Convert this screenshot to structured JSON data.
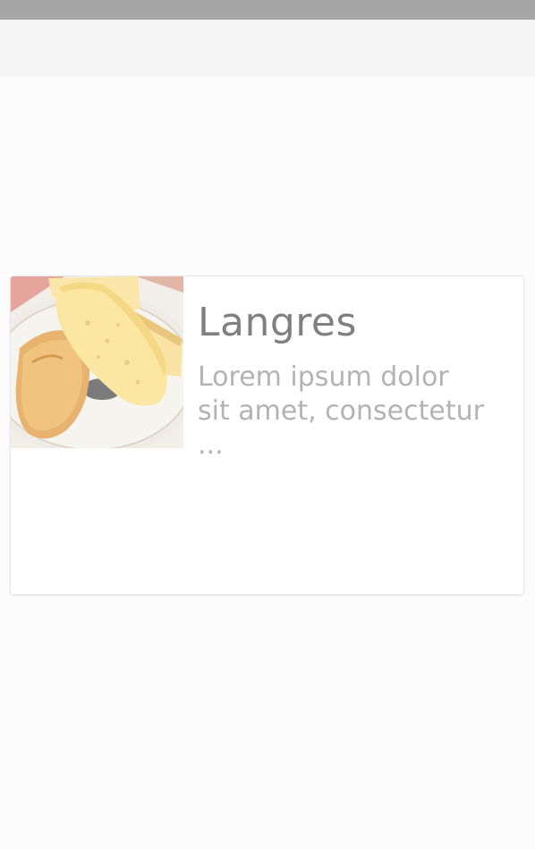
{
  "card": {
    "title": "Langres",
    "description_line1": "Lorem ipsum dolor",
    "description_line2": "sit amet, consectetur ...",
    "image_icon": "cheese-image"
  },
  "colors": {
    "status_bar": "#a6a6a6",
    "app_bar": "#f6f5f6",
    "background": "#fcfcfc",
    "title_text": "#808080",
    "description_text": "#b3b3b3"
  }
}
